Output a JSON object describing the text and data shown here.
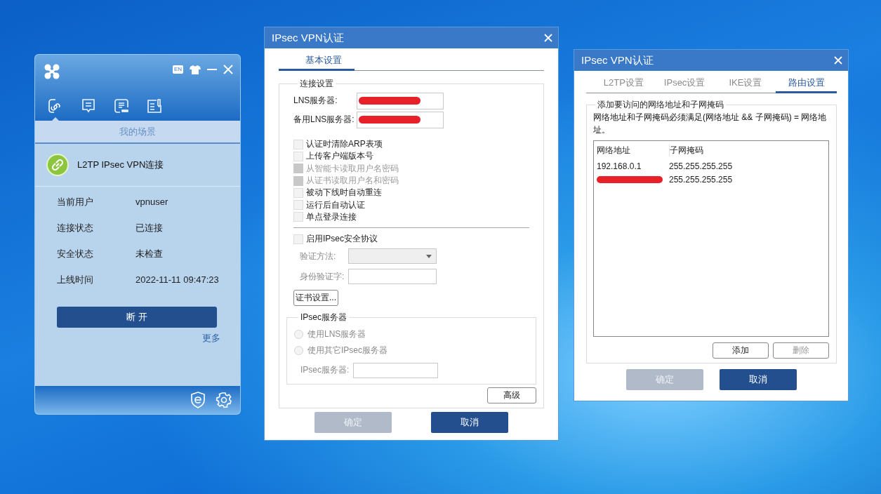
{
  "app": {
    "language_badge": "EN",
    "nav": [
      {
        "selected": true
      },
      {
        "selected": false
      },
      {
        "selected": false
      },
      {
        "selected": false
      }
    ],
    "section_title": "我的场景",
    "connection": {
      "name": "L2TP IPsec VPN连接"
    },
    "info": [
      {
        "label": "当前用户",
        "value": "vpnuser"
      },
      {
        "label": "连接状态",
        "value": "已连接"
      },
      {
        "label": "安全状态",
        "value": "未检查"
      },
      {
        "label": "上线时间",
        "value": "2022-11-11 09:47:23"
      }
    ],
    "disconnect_button": "断 开",
    "more_link": "更多"
  },
  "basic_dialog": {
    "title": "IPsec VPN认证",
    "tabs": [
      {
        "label": "基本设置",
        "selected": true
      }
    ],
    "connection_group": {
      "title": "连接设置",
      "fields": [
        {
          "label": "LNS服务器:",
          "redacted": true
        },
        {
          "label": "备用LNS服务器:",
          "redacted": true
        }
      ],
      "options": [
        {
          "label": "认证时清除ARP表项",
          "checked": false,
          "disabled": false
        },
        {
          "label": "上传客户端版本号",
          "checked": false,
          "disabled": false
        },
        {
          "label": "从智能卡读取用户名密码",
          "checked": false,
          "disabled": true
        },
        {
          "label": "从证书读取用户名和密码",
          "checked": false,
          "disabled": true
        },
        {
          "label": "被动下线时自动重连",
          "checked": false,
          "disabled": false
        },
        {
          "label": "运行后自动认证",
          "checked": false,
          "disabled": false
        },
        {
          "label": "单点登录连接",
          "checked": false,
          "disabled": false
        }
      ],
      "ipsec_option": {
        "label": "启用IPsec安全协议",
        "checked": false,
        "disabled": false
      },
      "auth_method": {
        "label": "验证方法:",
        "disabled": true
      },
      "identity_key": {
        "label": "身份验证字:",
        "disabled": true
      },
      "cert_button": "证书设置...",
      "server_group": {
        "title": "IPsec服务器",
        "radios": [
          {
            "label": "使用LNS服务器",
            "selected": false,
            "disabled": true
          },
          {
            "label": "使用其它IPsec服务器",
            "selected": false,
            "disabled": true
          }
        ],
        "server_field": {
          "label": "IPsec服务器:",
          "disabled": true
        }
      },
      "advanced_button": "高级"
    },
    "buttons": [
      {
        "label": "确定",
        "disabled": true
      },
      {
        "label": "取消",
        "disabled": false
      }
    ]
  },
  "route_dialog": {
    "title": "IPsec VPN认证",
    "tabs": [
      {
        "label": "L2TP设置",
        "selected": false
      },
      {
        "label": "IPsec设置",
        "selected": false
      },
      {
        "label": "IKE设置",
        "selected": false
      },
      {
        "label": "路由设置",
        "selected": true
      }
    ],
    "group": {
      "title": "添加要访问的网络地址和子网掩码",
      "note": "网络地址和子网掩码必须满足(网络地址 && 子网掩码) = 网络地址。",
      "columns": [
        "网络地址",
        "子网掩码"
      ],
      "rows": [
        {
          "address": "192.168.0.1",
          "mask": "255.255.255.255",
          "redacted": false
        },
        {
          "redacted": true,
          "mask": "255.255.255.255"
        }
      ],
      "buttons": [
        {
          "label": "添加",
          "disabled": false
        },
        {
          "label": "删除",
          "disabled": true
        }
      ]
    },
    "buttons": [
      {
        "label": "确定",
        "disabled": true
      },
      {
        "label": "取消",
        "disabled": false
      }
    ]
  }
}
